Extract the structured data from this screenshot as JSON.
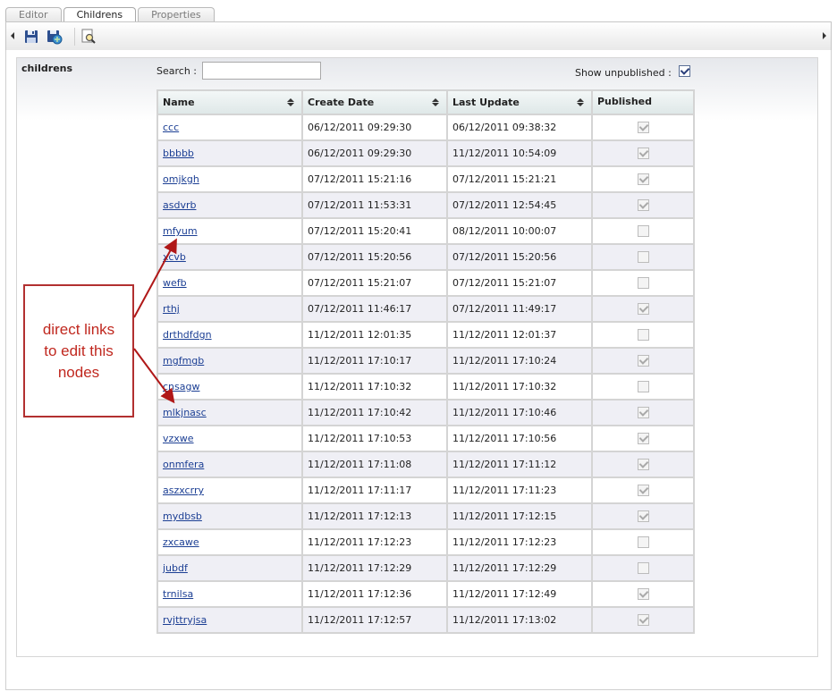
{
  "tabs": [
    {
      "label": "Editor",
      "active": false
    },
    {
      "label": "Childrens",
      "active": true
    },
    {
      "label": "Properties",
      "active": false
    }
  ],
  "toolbar": {
    "icons": [
      "save-icon",
      "save-publish-icon",
      "preview-icon"
    ]
  },
  "section_label": "childrens",
  "search": {
    "label": "Search :",
    "value": "",
    "placeholder": ""
  },
  "show_unpublished": {
    "label": "Show unpublished :",
    "checked": true
  },
  "table": {
    "columns": [
      "Name",
      "Create Date",
      "Last Update",
      "Published"
    ],
    "rows": [
      {
        "name": "ccc",
        "created": "06/12/2011 09:29:30",
        "updated": "06/12/2011 09:38:32",
        "published": true
      },
      {
        "name": "bbbbb",
        "created": "06/12/2011 09:29:30",
        "updated": "11/12/2011 10:54:09",
        "published": true
      },
      {
        "name": "omjkgh",
        "created": "07/12/2011 15:21:16",
        "updated": "07/12/2011 15:21:21",
        "published": true
      },
      {
        "name": "asdvrb",
        "created": "07/12/2011 11:53:31",
        "updated": "07/12/2011 12:54:45",
        "published": true
      },
      {
        "name": "mfyum",
        "created": "07/12/2011 15:20:41",
        "updated": "08/12/2011 10:00:07",
        "published": false
      },
      {
        "name": "xcvb",
        "created": "07/12/2011 15:20:56",
        "updated": "07/12/2011 15:20:56",
        "published": false
      },
      {
        "name": "wefb",
        "created": "07/12/2011 15:21:07",
        "updated": "07/12/2011 15:21:07",
        "published": false
      },
      {
        "name": "rthj",
        "created": "07/12/2011 11:46:17",
        "updated": "07/12/2011 11:49:17",
        "published": true
      },
      {
        "name": "drthdfdgn",
        "created": "11/12/2011 12:01:35",
        "updated": "11/12/2011 12:01:37",
        "published": false
      },
      {
        "name": "mgfmgb",
        "created": "11/12/2011 17:10:17",
        "updated": "11/12/2011 17:10:24",
        "published": true
      },
      {
        "name": "cnsagw",
        "created": "11/12/2011 17:10:32",
        "updated": "11/12/2011 17:10:32",
        "published": false
      },
      {
        "name": "mlkjnasc",
        "created": "11/12/2011 17:10:42",
        "updated": "11/12/2011 17:10:46",
        "published": true
      },
      {
        "name": "vzxwe",
        "created": "11/12/2011 17:10:53",
        "updated": "11/12/2011 17:10:56",
        "published": true
      },
      {
        "name": "onmfera",
        "created": "11/12/2011 17:11:08",
        "updated": "11/12/2011 17:11:12",
        "published": true
      },
      {
        "name": "aszxcrry",
        "created": "11/12/2011 17:11:17",
        "updated": "11/12/2011 17:11:23",
        "published": true
      },
      {
        "name": "mydbsb",
        "created": "11/12/2011 17:12:13",
        "updated": "11/12/2011 17:12:15",
        "published": true
      },
      {
        "name": "zxcawe",
        "created": "11/12/2011 17:12:23",
        "updated": "11/12/2011 17:12:23",
        "published": false
      },
      {
        "name": "jubdf",
        "created": "11/12/2011 17:12:29",
        "updated": "11/12/2011 17:12:29",
        "published": false
      },
      {
        "name": "trnilsa",
        "created": "11/12/2011 17:12:36",
        "updated": "11/12/2011 17:12:49",
        "published": true
      },
      {
        "name": "rvjttryjsa",
        "created": "11/12/2011 17:12:57",
        "updated": "11/12/2011 17:13:02",
        "published": true
      }
    ]
  },
  "annotation": {
    "lines": [
      "direct links",
      "to edit this",
      "nodes"
    ],
    "color": "#c0281f"
  }
}
